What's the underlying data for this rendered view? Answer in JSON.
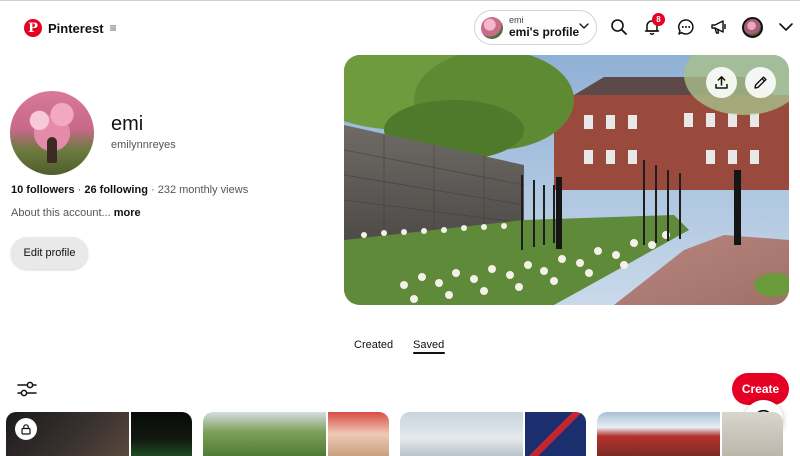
{
  "header": {
    "brand": "Pinterest",
    "menu_glyph": "≡",
    "profile_pill": {
      "sub": "emi",
      "main": "emi's profile"
    },
    "notification_count": "8",
    "icons": [
      "pinterest-logo-icon",
      "menu-icon",
      "chevron-down-icon",
      "search-icon",
      "bell-icon",
      "chat-icon",
      "megaphone-icon",
      "chevron-down-icon"
    ]
  },
  "profile": {
    "name": "emi",
    "handle": "emilynnreyes",
    "followers": "10 followers",
    "sep1": " · ",
    "following": "26 following",
    "sep2": " · ",
    "monthly_views": "232 monthly views",
    "about": "About this account...",
    "about_more": "more",
    "edit_button": "Edit profile"
  },
  "cover": {
    "actions": [
      "upload-icon",
      "pencil-icon"
    ]
  },
  "tabs": [
    {
      "label": "Created",
      "selected": false
    },
    {
      "label": "Saved",
      "selected": true
    }
  ],
  "actions": {
    "create": "Create",
    "help": "?"
  },
  "boards": [
    {
      "locked": true
    },
    {
      "locked": false
    },
    {
      "locked": false
    },
    {
      "locked": false
    }
  ],
  "colors": {
    "brand_red": "#e60023",
    "text": "#111111",
    "muted": "#555555",
    "button_gray": "#e9e9e9"
  }
}
